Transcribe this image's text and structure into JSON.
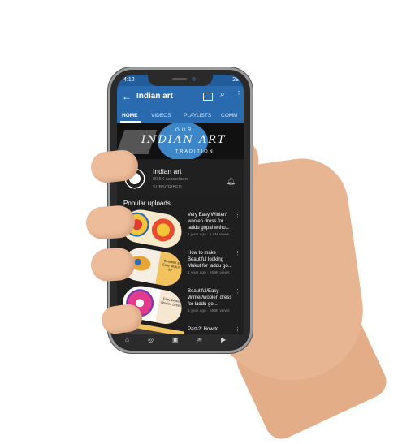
{
  "status": {
    "time": "4:12",
    "battery": "28"
  },
  "appbar": {
    "title": "Indian art"
  },
  "tabs": [
    "HOME",
    "VIDEOS",
    "PLAYLISTS",
    "COMM"
  ],
  "banner": {
    "line1": "OUR",
    "line2": "INDIAN ART",
    "line3": "TRADITION"
  },
  "channel": {
    "name": "Indian art",
    "subscribers": "80.5K subscribers",
    "status": "SUBSCRIBED",
    "avatar_text": "INDIAN ART"
  },
  "section_title": "Popular uploads",
  "videos": [
    {
      "title": "Very Easy Winter/ woolen dress for laddu gopal witho...",
      "meta": "1 year ago · 1.6M views",
      "thumb_text": ""
    },
    {
      "title": "How to make Beautiful looking Mukut for laddu go...",
      "meta": "1 year ago · 669K views",
      "thumb_text": "Beautiful & Easy Mukut for"
    },
    {
      "title": "Beautiful/Easy Winter/woolen dress for laddu go...",
      "meta": "1 year ago · 593K views",
      "thumb_text": "Easy Winter Woolen Dress"
    },
    {
      "title": "Part-2: How to",
      "meta": "",
      "thumb_text": ""
    }
  ],
  "colors": {
    "appbar": "#2a6aae",
    "background": "#1f1f1f"
  },
  "icons": [
    "back-arrow-icon",
    "cast-icon",
    "search-icon",
    "more-vert-icon",
    "bell-icon",
    "home-icon",
    "explore-icon",
    "subscriptions-icon",
    "inbox-icon",
    "library-icon"
  ]
}
